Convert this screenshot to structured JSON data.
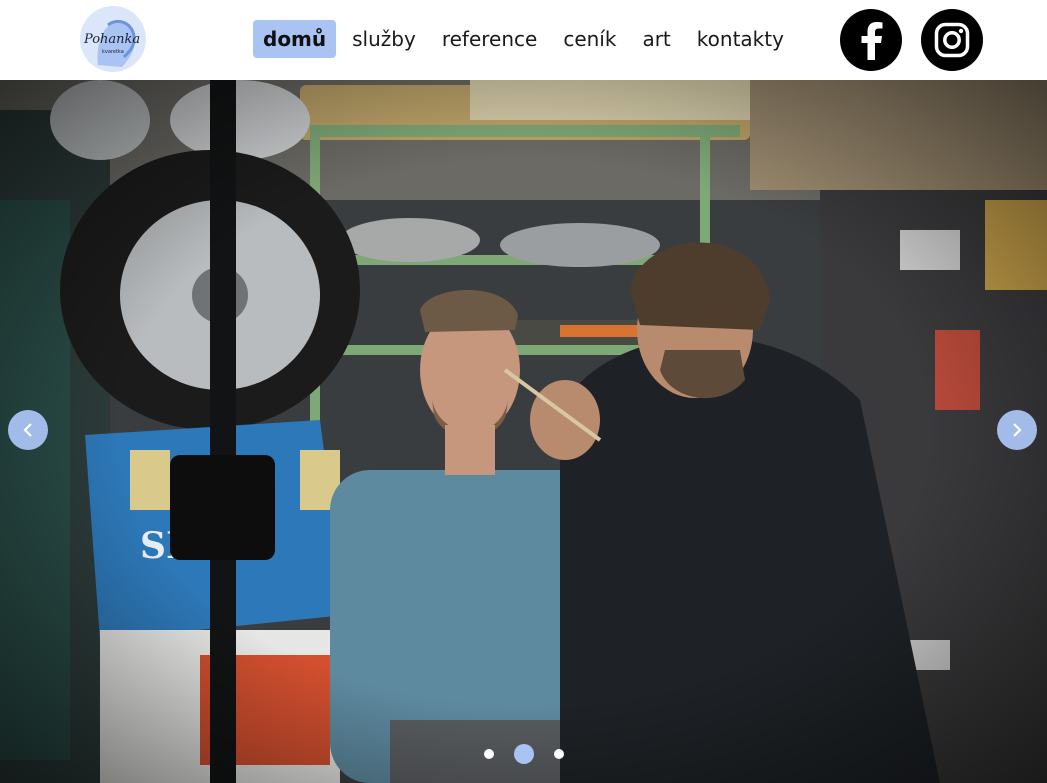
{
  "header": {
    "logo_text": "Pohanka",
    "logo_subtext": "kvaretka",
    "nav": [
      {
        "label": "domů",
        "active": true
      },
      {
        "label": "služby",
        "active": false
      },
      {
        "label": "reference",
        "active": false
      },
      {
        "label": "ceník",
        "active": false
      },
      {
        "label": "art",
        "active": false
      },
      {
        "label": "kontakty",
        "active": false
      }
    ],
    "social": [
      {
        "icon": "facebook-icon"
      },
      {
        "icon": "instagram-icon"
      }
    ]
  },
  "slider": {
    "prev_icon": "chevron-left-icon",
    "next_icon": "chevron-right-icon",
    "dots": 3,
    "active_dot": 2
  },
  "colors": {
    "accent": "#a9c3f2",
    "header_bg": "#ffffff",
    "social_bg": "#000000"
  }
}
